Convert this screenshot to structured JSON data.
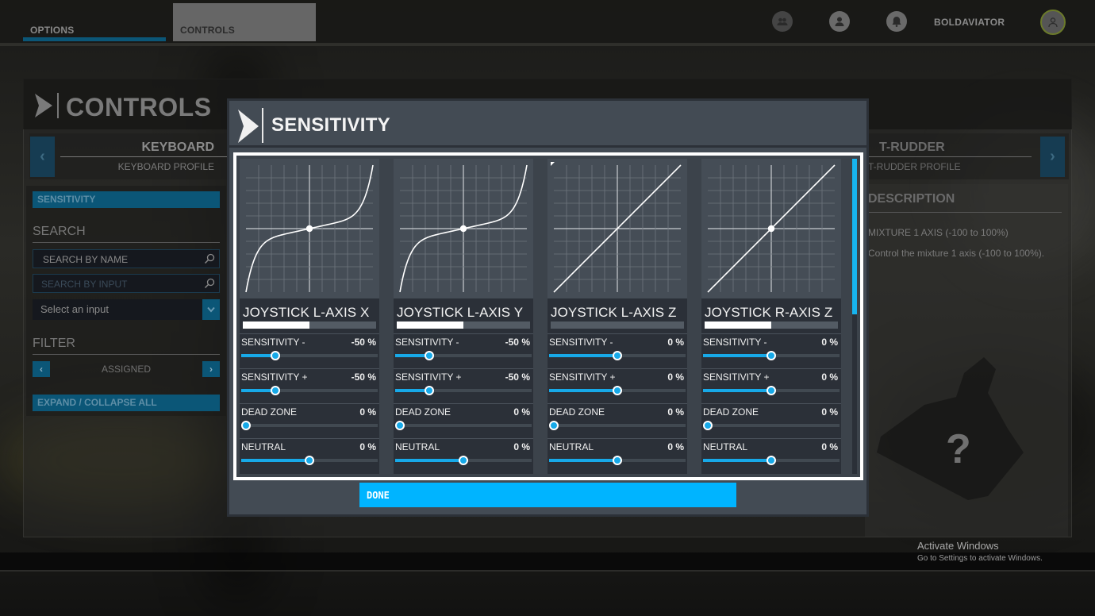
{
  "topbar": {
    "tabs": [
      {
        "label": "OPTIONS",
        "active": false
      },
      {
        "label": "CONTROLS",
        "active": true
      }
    ],
    "icons": [
      "friends-icon",
      "profile-icon",
      "notifications-bell-icon"
    ],
    "username": "BOLDAVIATOR"
  },
  "controls_page": {
    "title": "CONTROLS",
    "profiles": {
      "left": {
        "name": "KEYBOARD",
        "subtitle": "KEYBOARD PROFILE"
      },
      "right": {
        "name": "T-RUDDER",
        "subtitle": "T-RUDDER PROFILE"
      }
    },
    "sidebar": {
      "sensitivity_button": "SENSITIVITY",
      "search_heading": "SEARCH",
      "search_by_name_placeholder": "SEARCH BY NAME",
      "search_by_input_placeholder": "SEARCH BY INPUT",
      "select_input": "Select an input",
      "filter_heading": "FILTER",
      "filter_value": "ASSIGNED",
      "expand_collapse": "EXPAND / COLLAPSE ALL"
    },
    "description": {
      "heading": "DESCRIPTION",
      "line1": "MIXTURE 1 AXIS (-100 to 100%)",
      "line2": "Control the mixture 1 axis (-100 to 100%).",
      "device_placeholder": "?"
    }
  },
  "sensitivity_modal": {
    "title": "SENSITIVITY",
    "done_label": "DONE",
    "param_labels": [
      "SENSITIVITY -",
      "SENSITIVITY +",
      "DEAD ZONE",
      "NEUTRAL"
    ],
    "axes": [
      {
        "name": "JOYSTICK L-AXIS X",
        "input_position": 0.5,
        "show_neutral_dot": true,
        "curve": "s-curve",
        "params": [
          {
            "label": "SENSITIVITY -",
            "value": -50,
            "display": "-50 %"
          },
          {
            "label": "SENSITIVITY +",
            "value": -50,
            "display": "-50 %"
          },
          {
            "label": "DEAD ZONE",
            "value": 0,
            "display": "0 %"
          },
          {
            "label": "NEUTRAL",
            "value": 0,
            "display": "0 %"
          }
        ]
      },
      {
        "name": "JOYSTICK L-AXIS Y",
        "input_position": 0.5,
        "show_neutral_dot": true,
        "curve": "s-curve",
        "params": [
          {
            "label": "SENSITIVITY -",
            "value": -50,
            "display": "-50 %"
          },
          {
            "label": "SENSITIVITY +",
            "value": -50,
            "display": "-50 %"
          },
          {
            "label": "DEAD ZONE",
            "value": 0,
            "display": "0 %"
          },
          {
            "label": "NEUTRAL",
            "value": 0,
            "display": "0 %"
          }
        ]
      },
      {
        "name": "JOYSTICK L-AXIS Z",
        "input_position": 0.0,
        "show_neutral_dot": false,
        "curve": "linear",
        "params": [
          {
            "label": "SENSITIVITY -",
            "value": 0,
            "display": "0 %"
          },
          {
            "label": "SENSITIVITY +",
            "value": 0,
            "display": "0 %"
          },
          {
            "label": "DEAD ZONE",
            "value": 0,
            "display": "0 %"
          },
          {
            "label": "NEUTRAL",
            "value": 0,
            "display": "0 %"
          }
        ]
      },
      {
        "name": "JOYSTICK R-AXIS Z",
        "input_position": 0.5,
        "show_neutral_dot": true,
        "curve": "linear",
        "params": [
          {
            "label": "SENSITIVITY -",
            "value": 0,
            "display": "0 %"
          },
          {
            "label": "SENSITIVITY +",
            "value": 0,
            "display": "0 %"
          },
          {
            "label": "DEAD ZONE",
            "value": 0,
            "display": "0 %"
          },
          {
            "label": "NEUTRAL",
            "value": 0,
            "display": "0 %"
          }
        ]
      }
    ],
    "scroll_position": 0.0
  },
  "windows_watermark": {
    "title": "Activate Windows",
    "subtitle": "Go to Settings to activate Windows."
  },
  "colors": {
    "accent": "#00b4ff",
    "slider_blue": "#17a9e8",
    "dim_blue": "#0b5677",
    "modal_bg": "#434b54",
    "column_bg": "#2b3038"
  }
}
